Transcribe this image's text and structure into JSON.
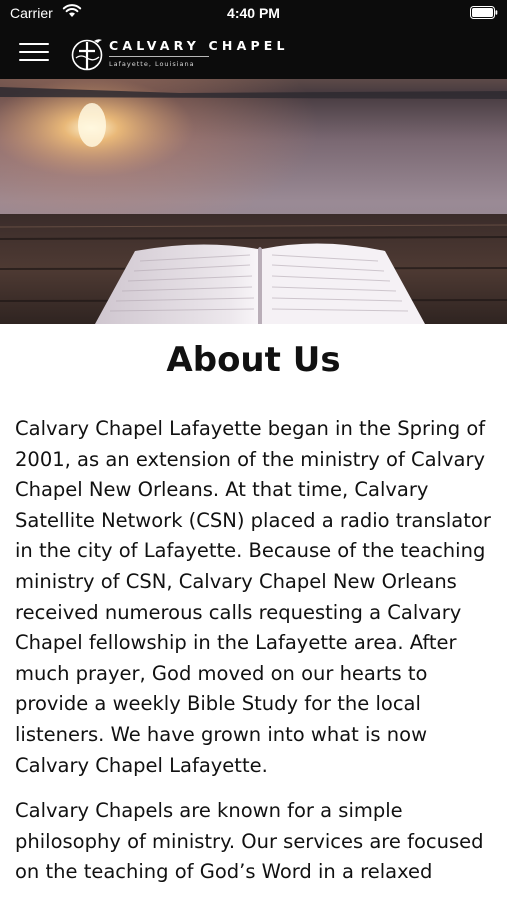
{
  "status_bar": {
    "carrier": "Carrier",
    "time": "4:40 PM",
    "wifi_icon": "wifi-icon",
    "battery_icon": "battery-icon"
  },
  "nav": {
    "menu_icon": "hamburger-menu-icon",
    "logo_name": "CALVARY CHAPEL",
    "logo_subtitle": "Lafayette, Louisiana",
    "logo_icon": "cross-dove-logo-icon"
  },
  "hero": {
    "image": "open bible on wooden dock at sunset over lake"
  },
  "page": {
    "title": "About Us",
    "paragraphs": [
      "Calvary Chapel Lafayette began in the Spring of 2001, as an extension of the ministry of Calvary Chapel New Orleans. At that time, Calvary Satellite Network (CSN) placed a radio translator in the city of Lafayette. Because of the teaching ministry of CSN, Calvary Chapel New Orleans received numerous calls requesting a Calvary Chapel fellowship in the Lafayette area. After much prayer, God moved on our hearts to provide a weekly Bible Study for the local listeners. We have grown into what is now Calvary Chapel Lafayette.",
      "Calvary Chapels are known for a simple philosophy of ministry. Our services are focused on the teaching of God’s Word in a relaxed"
    ]
  },
  "colors": {
    "topbar": "#0c0c0c",
    "text": "#111111",
    "background": "#ffffff"
  }
}
